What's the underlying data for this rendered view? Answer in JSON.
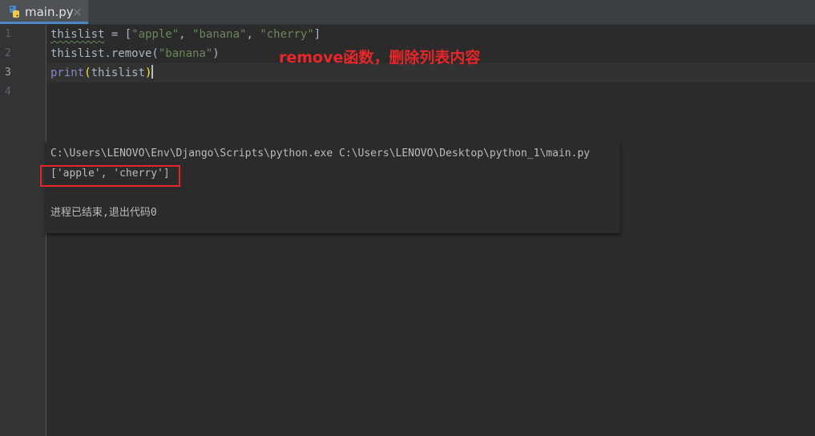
{
  "tab": {
    "filename": "main.py",
    "close_glyph": "×",
    "icon": "python-file-icon"
  },
  "editor": {
    "line_numbers": [
      "1",
      "2",
      "3",
      "4"
    ],
    "active_line": 3,
    "lines": {
      "l1": {
        "var": "thislist",
        "eq": " = [",
        "s1": "\"apple\"",
        "c1": ", ",
        "s2": "\"banana\"",
        "c2": ", ",
        "s3": "\"cherry\"",
        "end": "]"
      },
      "l2": {
        "call": "thislist.remove(",
        "arg": "\"banana\"",
        "end": ")"
      },
      "l3": {
        "builtin": "print",
        "open": "(",
        "arg": "thislist",
        "close": ")"
      }
    }
  },
  "annotation": "remove函数，删除列表内容",
  "console": {
    "command": "C:\\Users\\LENOVO\\Env\\Django\\Scripts\\python.exe C:\\Users\\LENOVO\\Desktop\\python_1\\main.py",
    "output": "['apple', 'cherry']",
    "exit_message": "进程已结束,退出代码0"
  },
  "colors": {
    "background": "#2b2b2b",
    "annotation": "#e8262a",
    "string": "#6a8759",
    "builtin": "#8888c6",
    "bracket_match": "#ffef28"
  }
}
